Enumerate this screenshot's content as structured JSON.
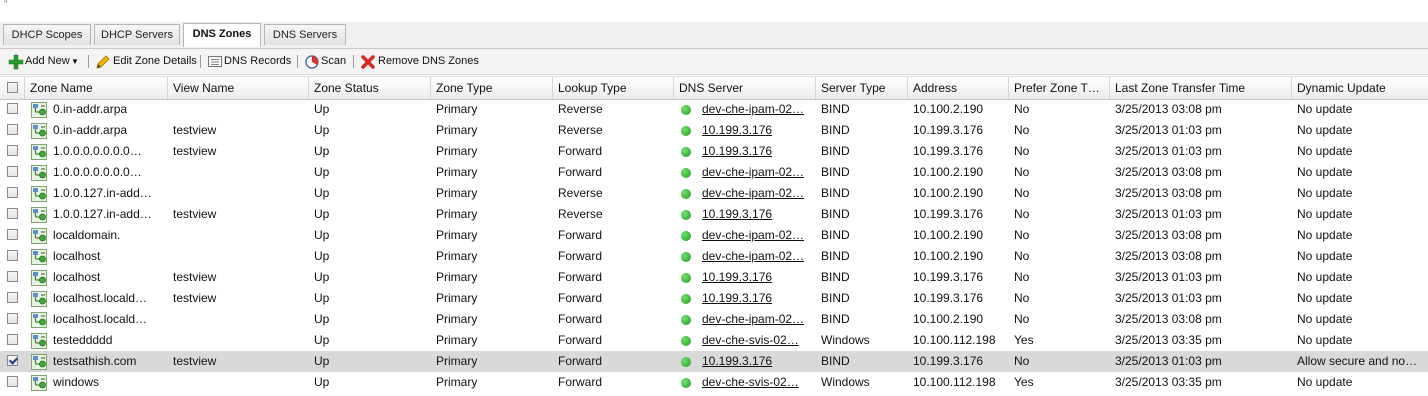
{
  "tabs": [
    {
      "label": "DHCP Scopes",
      "active": false
    },
    {
      "label": "DHCP Servers",
      "active": false
    },
    {
      "label": "DNS Zones",
      "active": true
    },
    {
      "label": "DNS Servers",
      "active": false
    }
  ],
  "toolbar": {
    "add_new": "Add New",
    "edit_zone_details": "Edit Zone Details",
    "dns_records": "DNS Records",
    "scan": "Scan",
    "remove_dns_zones": "Remove DNS Zones"
  },
  "columns": [
    "Zone Name",
    "View Name",
    "Zone Status",
    "Zone Type",
    "Lookup Type",
    "DNS Server",
    "Server Type",
    "Address",
    "Prefer Zone T…",
    "Last Zone Transfer Time",
    "Dynamic Update"
  ],
  "rows": [
    {
      "zone": "0.in-addr.arpa",
      "view": "",
      "status": "Up",
      "type": "Primary",
      "lookup": "Reverse",
      "server": "dev-che-ipam-02…",
      "stype": "BIND",
      "address": "10.100.2.190",
      "prefer": "No",
      "last": "3/25/2013 03:08 pm",
      "dynamic": "No update",
      "selected": false
    },
    {
      "zone": "0.in-addr.arpa",
      "view": "testview",
      "status": "Up",
      "type": "Primary",
      "lookup": "Reverse",
      "server": "10.199.3.176",
      "stype": "BIND",
      "address": "10.199.3.176",
      "prefer": "No",
      "last": "3/25/2013 01:03 pm",
      "dynamic": "No update",
      "selected": false
    },
    {
      "zone": "1.0.0.0.0.0.0.0…",
      "view": "testview",
      "status": "Up",
      "type": "Primary",
      "lookup": "Forward",
      "server": "10.199.3.176",
      "stype": "BIND",
      "address": "10.199.3.176",
      "prefer": "No",
      "last": "3/25/2013 01:03 pm",
      "dynamic": "No update",
      "selected": false
    },
    {
      "zone": "1.0.0.0.0.0.0.0…",
      "view": "",
      "status": "Up",
      "type": "Primary",
      "lookup": "Forward",
      "server": "dev-che-ipam-02…",
      "stype": "BIND",
      "address": "10.100.2.190",
      "prefer": "No",
      "last": "3/25/2013 03:08 pm",
      "dynamic": "No update",
      "selected": false
    },
    {
      "zone": "1.0.0.127.in-add…",
      "view": "",
      "status": "Up",
      "type": "Primary",
      "lookup": "Reverse",
      "server": "dev-che-ipam-02…",
      "stype": "BIND",
      "address": "10.100.2.190",
      "prefer": "No",
      "last": "3/25/2013 03:08 pm",
      "dynamic": "No update",
      "selected": false
    },
    {
      "zone": "1.0.0.127.in-add…",
      "view": "testview",
      "status": "Up",
      "type": "Primary",
      "lookup": "Reverse",
      "server": "10.199.3.176",
      "stype": "BIND",
      "address": "10.199.3.176",
      "prefer": "No",
      "last": "3/25/2013 01:03 pm",
      "dynamic": "No update",
      "selected": false
    },
    {
      "zone": "localdomain.",
      "view": "",
      "status": "Up",
      "type": "Primary",
      "lookup": "Forward",
      "server": "dev-che-ipam-02…",
      "stype": "BIND",
      "address": "10.100.2.190",
      "prefer": "No",
      "last": "3/25/2013 03:08 pm",
      "dynamic": "No update",
      "selected": false
    },
    {
      "zone": "localhost",
      "view": "",
      "status": "Up",
      "type": "Primary",
      "lookup": "Forward",
      "server": "dev-che-ipam-02…",
      "stype": "BIND",
      "address": "10.100.2.190",
      "prefer": "No",
      "last": "3/25/2013 03:08 pm",
      "dynamic": "No update",
      "selected": false
    },
    {
      "zone": "localhost",
      "view": "testview",
      "status": "Up",
      "type": "Primary",
      "lookup": "Forward",
      "server": "10.199.3.176",
      "stype": "BIND",
      "address": "10.199.3.176",
      "prefer": "No",
      "last": "3/25/2013 01:03 pm",
      "dynamic": "No update",
      "selected": false
    },
    {
      "zone": "localhost.locald…",
      "view": "testview",
      "status": "Up",
      "type": "Primary",
      "lookup": "Forward",
      "server": "10.199.3.176",
      "stype": "BIND",
      "address": "10.199.3.176",
      "prefer": "No",
      "last": "3/25/2013 01:03 pm",
      "dynamic": "No update",
      "selected": false
    },
    {
      "zone": "localhost.locald…",
      "view": "",
      "status": "Up",
      "type": "Primary",
      "lookup": "Forward",
      "server": "dev-che-ipam-02…",
      "stype": "BIND",
      "address": "10.100.2.190",
      "prefer": "No",
      "last": "3/25/2013 03:08 pm",
      "dynamic": "No update",
      "selected": false
    },
    {
      "zone": "testeddddd",
      "view": "",
      "status": "Up",
      "type": "Primary",
      "lookup": "Forward",
      "server": "dev-che-svis-02…",
      "stype": "Windows",
      "address": "10.100.112.198",
      "prefer": "Yes",
      "last": "3/25/2013 03:35 pm",
      "dynamic": "No update",
      "selected": false
    },
    {
      "zone": "testsathish.com",
      "view": "testview",
      "status": "Up",
      "type": "Primary",
      "lookup": "Forward",
      "server": "10.199.3.176",
      "stype": "BIND",
      "address": "10.199.3.176",
      "prefer": "No",
      "last": "3/25/2013 01:03 pm",
      "dynamic": "Allow secure and no…",
      "selected": true
    },
    {
      "zone": "windows",
      "view": "",
      "status": "Up",
      "type": "Primary",
      "lookup": "Forward",
      "server": "dev-che-svis-02…",
      "stype": "Windows",
      "address": "10.100.112.198",
      "prefer": "Yes",
      "last": "3/25/2013 03:35 pm",
      "dynamic": "No update",
      "selected": false
    }
  ]
}
